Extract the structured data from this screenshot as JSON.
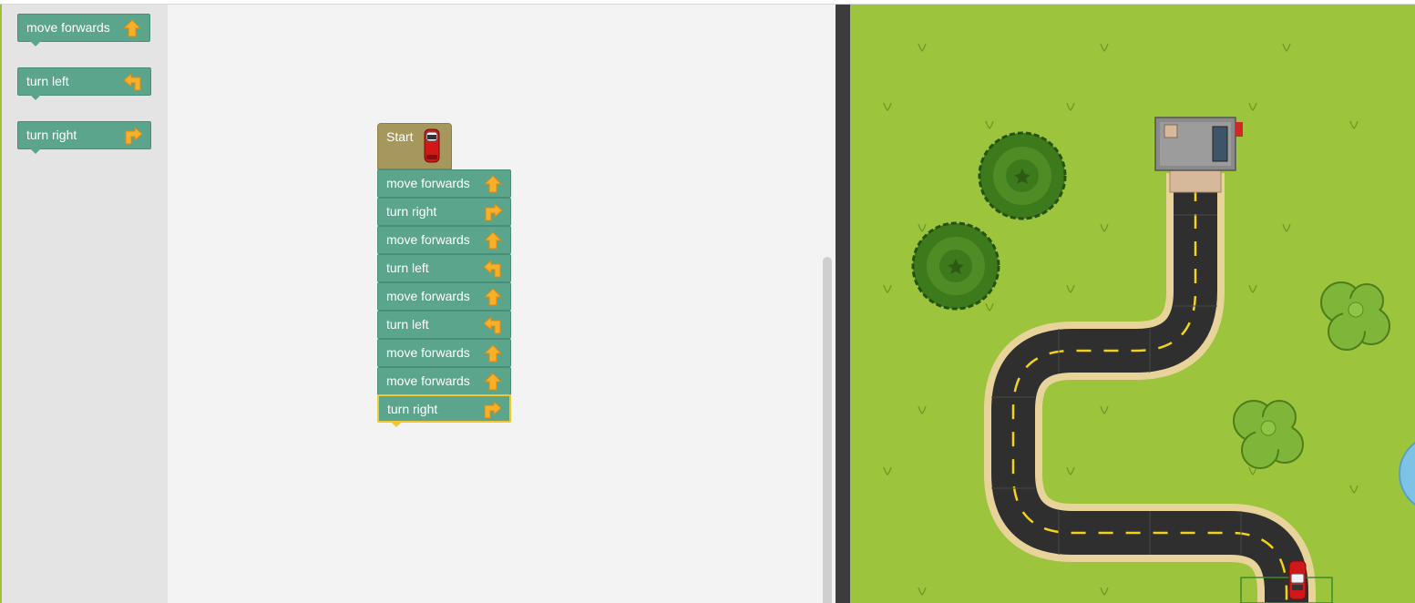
{
  "toolbox": {
    "items": [
      {
        "label": "move forwards",
        "icon": "arrow-up-icon"
      },
      {
        "label": "turn left",
        "icon": "turn-left-icon"
      },
      {
        "label": "turn right",
        "icon": "turn-right-icon"
      }
    ]
  },
  "workspace": {
    "start_label": "Start",
    "program": [
      {
        "label": "move forwards",
        "icon": "arrow-up-icon"
      },
      {
        "label": "turn right",
        "icon": "turn-right-icon"
      },
      {
        "label": "move forwards",
        "icon": "arrow-up-icon"
      },
      {
        "label": "turn left",
        "icon": "turn-left-icon"
      },
      {
        "label": "move forwards",
        "icon": "arrow-up-icon"
      },
      {
        "label": "turn left",
        "icon": "turn-left-icon"
      },
      {
        "label": "move forwards",
        "icon": "arrow-up-icon"
      },
      {
        "label": "move forwards",
        "icon": "arrow-up-icon"
      },
      {
        "label": "turn right",
        "icon": "turn-right-icon",
        "selected": true
      }
    ]
  },
  "colors": {
    "block": "#5ba58c",
    "start_block": "#a6975c",
    "arrow": "#f6b02a",
    "grass": "#9dc43d",
    "road": "#2f2f2f",
    "road_edge": "#e8d49a",
    "lane": "#f2d21c",
    "selection": "#f2c72e"
  }
}
